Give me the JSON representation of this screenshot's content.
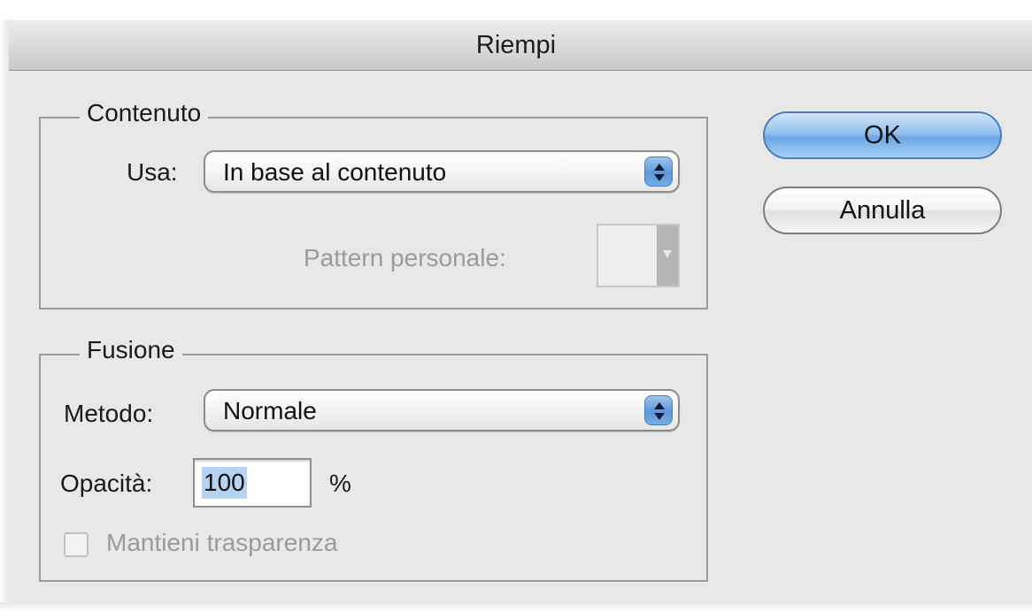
{
  "window": {
    "title": "Riempi"
  },
  "contenuto": {
    "group_label": "Contenuto",
    "usa_label": "Usa:",
    "usa_value": "In base al contenuto",
    "pattern_label": "Pattern personale:"
  },
  "fusione": {
    "group_label": "Fusione",
    "metodo_label": "Metodo:",
    "metodo_value": "Normale",
    "opacita_label": "Opacità:",
    "opacita_value": "100",
    "opacita_unit": "%",
    "mantieni_label": "Mantieni trasparenza",
    "mantieni_checked": false
  },
  "buttons": {
    "ok_label": "OK",
    "cancel_label": "Annulla"
  },
  "icons": {
    "popup_arrows": "updown-arrows-icon",
    "pattern_arrow": "chevron-down-icon"
  },
  "colors": {
    "accent": "#6aa6e3",
    "selection": "#b7d3f2",
    "disabled_text": "#9b9b9b"
  }
}
